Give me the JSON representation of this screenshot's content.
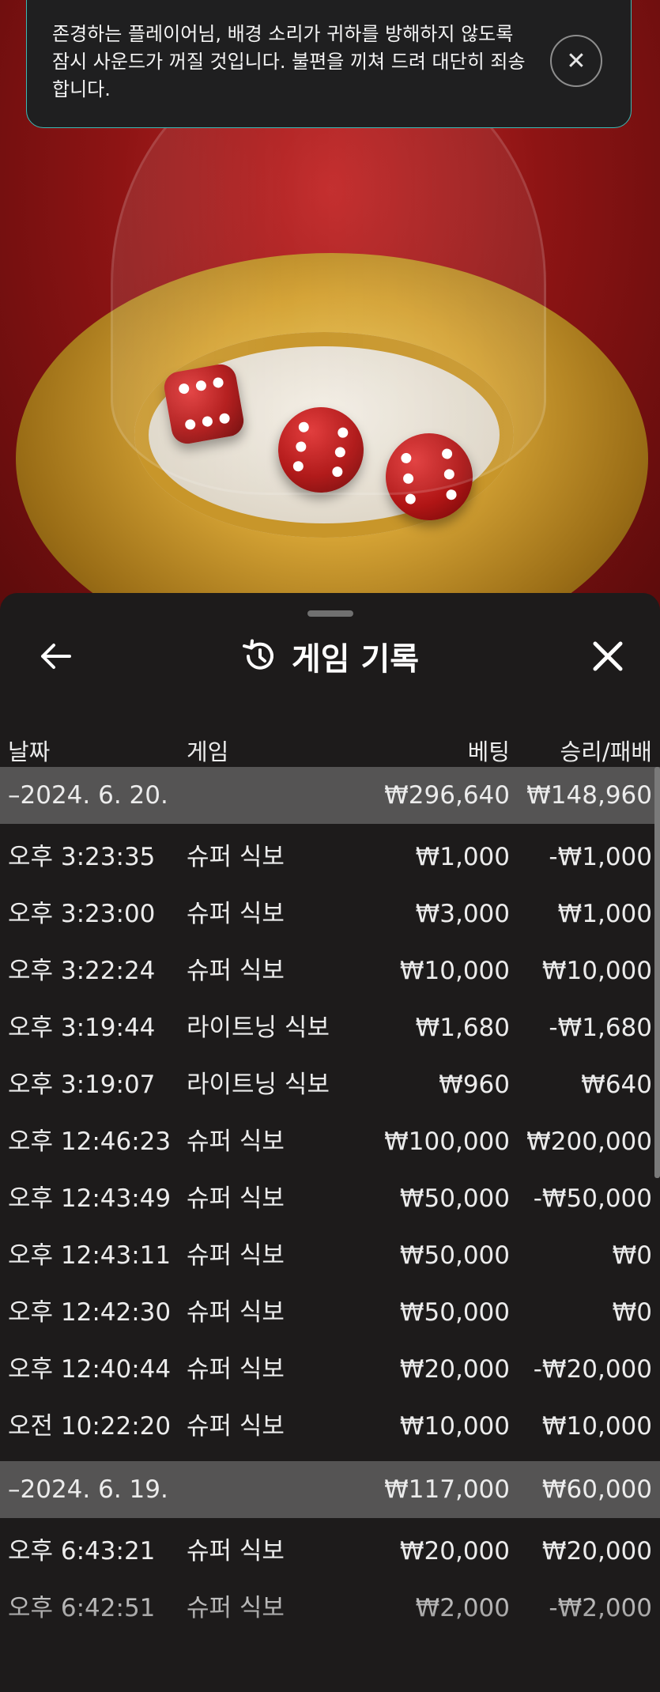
{
  "notification": {
    "message": "존경하는 플레이어님, 배경 소리가 귀하를 방해하지 않도록 잠시 사운드가 꺼질 것입니다. 불편을 끼쳐 드려 대단히 죄송합니다."
  },
  "history": {
    "title": "게임 기록",
    "columns": {
      "date": "날짜",
      "game": "게임",
      "bet": "베팅",
      "result": "승리/패배"
    },
    "groups": [
      {
        "date": "–2024. 6. 20.",
        "bet_total": "₩296,640",
        "result_total": "₩148,960",
        "rows": [
          {
            "time": "오후 3:23:35",
            "game": "슈퍼 식보",
            "bet": "₩1,000",
            "result": "-₩1,000"
          },
          {
            "time": "오후 3:23:00",
            "game": "슈퍼 식보",
            "bet": "₩3,000",
            "result": "₩1,000"
          },
          {
            "time": "오후 3:22:24",
            "game": "슈퍼 식보",
            "bet": "₩10,000",
            "result": "₩10,000"
          },
          {
            "time": "오후 3:19:44",
            "game": "라이트닝 식보",
            "bet": "₩1,680",
            "result": "-₩1,680"
          },
          {
            "time": "오후 3:19:07",
            "game": "라이트닝 식보",
            "bet": "₩960",
            "result": "₩640"
          },
          {
            "time": "오후 12:46:23",
            "game": "슈퍼 식보",
            "bet": "₩100,000",
            "result": "₩200,000"
          },
          {
            "time": "오후 12:43:49",
            "game": "슈퍼 식보",
            "bet": "₩50,000",
            "result": "-₩50,000"
          },
          {
            "time": "오후 12:43:11",
            "game": "슈퍼 식보",
            "bet": "₩50,000",
            "result": "₩0"
          },
          {
            "time": "오후 12:42:30",
            "game": "슈퍼 식보",
            "bet": "₩50,000",
            "result": "₩0"
          },
          {
            "time": "오후 12:40:44",
            "game": "슈퍼 식보",
            "bet": "₩20,000",
            "result": "-₩20,000"
          },
          {
            "time": "오전 10:22:20",
            "game": "슈퍼 식보",
            "bet": "₩10,000",
            "result": "₩10,000"
          }
        ]
      },
      {
        "date": "–2024. 6. 19.",
        "bet_total": "₩117,000",
        "result_total": "₩60,000",
        "rows": [
          {
            "time": "오후 6:43:21",
            "game": "슈퍼 식보",
            "bet": "₩20,000",
            "result": "₩20,000"
          },
          {
            "time": "오후 6:42:51",
            "game": "슈퍼 식보",
            "bet": "₩2,000",
            "result": "-₩2,000"
          }
        ]
      }
    ]
  },
  "icons": {
    "back": "arrow-left-icon",
    "history": "history-icon",
    "close": "close-icon",
    "toast_close": "close-icon"
  },
  "colors": {
    "sheet_bg": "#1d1b1b",
    "date_row_bg": "#555454",
    "toast_border": "#3cb8b4",
    "table_red": "#8e1414",
    "dice_red": "#b01515",
    "gold": "#d4a234"
  }
}
